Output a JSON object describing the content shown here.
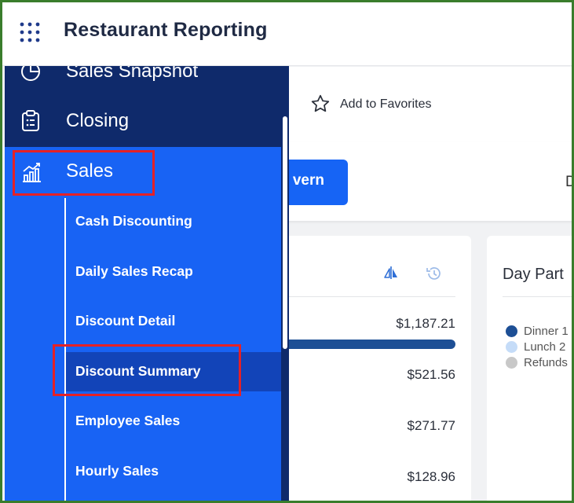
{
  "header": {
    "title": "Restaurant Reporting"
  },
  "toolbar": {
    "favorites_label": "Add to Favorites"
  },
  "filters": {
    "location_partial": "vern",
    "other_partial": "D"
  },
  "sidebar": {
    "items": [
      {
        "label": "Sales Snapshot",
        "icon": "pie-chart-icon"
      },
      {
        "label": "Closing",
        "icon": "clipboard-icon"
      },
      {
        "label": "Sales",
        "icon": "chart-up-icon",
        "expanded": true
      }
    ],
    "sales_subitems": [
      {
        "label": "Cash Discounting"
      },
      {
        "label": "Daily Sales Recap"
      },
      {
        "label": "Discount Detail"
      },
      {
        "label": "Discount Summary",
        "active": true
      },
      {
        "label": "Employee Sales"
      },
      {
        "label": "Hourly Sales"
      }
    ]
  },
  "summary_card": {
    "amounts": [
      "$1,187.21",
      "$521.56",
      "$271.77",
      "$128.96"
    ]
  },
  "day_part_card": {
    "title": "Day Part",
    "legend": [
      {
        "label": "Dinner",
        "value_partial": "1",
        "color": "#1d4f95"
      },
      {
        "label": "Lunch",
        "value_partial": "2",
        "color": "#c5dcf8"
      },
      {
        "label": "Refunds",
        "value_partial": "",
        "color": "#c8c8c8"
      }
    ]
  },
  "colors": {
    "sidebar_dark": "#0f2a6b",
    "sidebar_accent": "#1863f4",
    "highlight": "#e52126"
  }
}
